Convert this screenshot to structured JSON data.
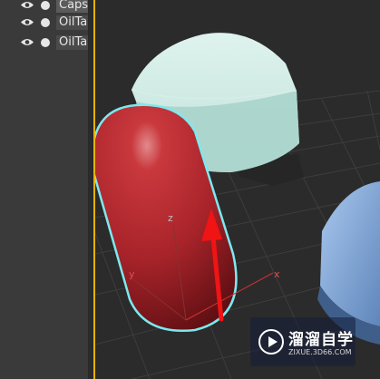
{
  "scene_explorer": {
    "items": [
      {
        "label": "Caps",
        "selected": true
      },
      {
        "label": "OilTa",
        "selected": false
      },
      {
        "label": "OilTa",
        "selected": false
      }
    ]
  },
  "viewport": {
    "axis_labels": {
      "z": "z",
      "y": "y",
      "x": "x"
    }
  },
  "watermark": {
    "title": "溜溜自学",
    "url": "ZIXUE.3D66.COM"
  },
  "colors": {
    "capsule": "#b3262b",
    "selection_outline": "#7ce9ef",
    "dome_mint": "#bfe3da",
    "dome_blue": "#7ea8d8",
    "viewport_active_border": "#e5b400",
    "move_arrow": "#f01414"
  }
}
